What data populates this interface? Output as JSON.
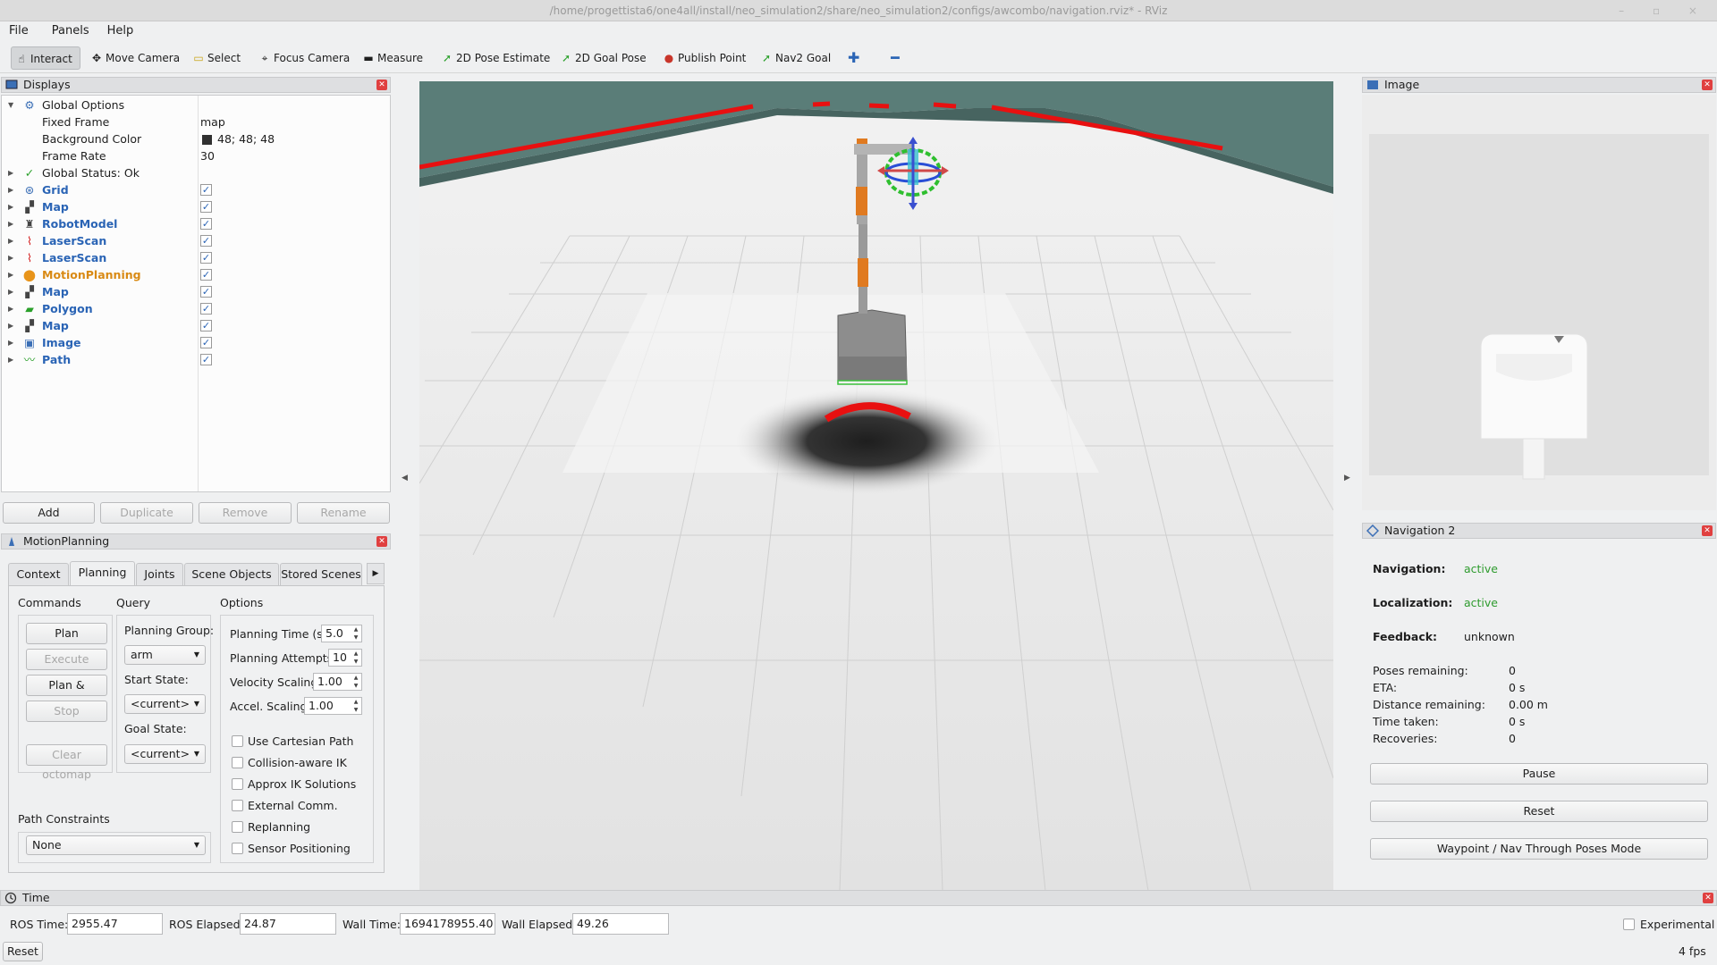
{
  "window": {
    "title": "/home/progettista6/one4all/install/neo_simulation2/share/neo_simulation2/configs/awcombo/navigation.rviz* - RViz"
  },
  "menu": [
    "File",
    "Panels",
    "Help"
  ],
  "toolbar": {
    "items": [
      {
        "label": "Interact",
        "icon": "interact-icon"
      },
      {
        "label": "Move Camera",
        "icon": "move-camera-icon"
      },
      {
        "label": "Select",
        "icon": "select-icon"
      },
      {
        "label": "Focus Camera",
        "icon": "focus-camera-icon"
      },
      {
        "label": "Measure",
        "icon": "measure-icon"
      },
      {
        "label": "2D Pose Estimate",
        "icon": "pose-estimate-icon"
      },
      {
        "label": "2D Goal Pose",
        "icon": "goal-pose-icon"
      },
      {
        "label": "Publish Point",
        "icon": "publish-point-icon"
      },
      {
        "label": "Nav2 Goal",
        "icon": "nav2-goal-icon"
      }
    ]
  },
  "displays": {
    "title": "Displays",
    "global_options": "Global Options",
    "fixed_frame": {
      "label": "Fixed Frame",
      "value": "map"
    },
    "background_color": {
      "label": "Background Color",
      "value": "48; 48; 48"
    },
    "frame_rate": {
      "label": "Frame Rate",
      "value": "30"
    },
    "global_status": "Global Status: Ok",
    "items": [
      {
        "label": "Grid",
        "checked": true
      },
      {
        "label": "Map",
        "checked": true
      },
      {
        "label": "RobotModel",
        "checked": true
      },
      {
        "label": "LaserScan",
        "checked": true
      },
      {
        "label": "LaserScan",
        "checked": true
      },
      {
        "label": "MotionPlanning",
        "checked": true
      },
      {
        "label": "Map",
        "checked": true
      },
      {
        "label": "Polygon",
        "checked": true
      },
      {
        "label": "Map",
        "checked": true
      },
      {
        "label": "Image",
        "checked": true
      },
      {
        "label": "Path",
        "checked": true
      }
    ],
    "buttons": {
      "add": "Add",
      "duplicate": "Duplicate",
      "remove": "Remove",
      "rename": "Rename"
    }
  },
  "motion_planning": {
    "title": "MotionPlanning",
    "tabs": [
      "Context",
      "Planning",
      "Joints",
      "Scene Objects",
      "Stored Scenes"
    ],
    "commands": {
      "title": "Commands",
      "plan": "Plan",
      "execute": "Execute",
      "plan_execute": "Plan & Execute",
      "stop": "Stop",
      "clear_octomap": "Clear octomap"
    },
    "query": {
      "title": "Query",
      "planning_group_label": "Planning Group:",
      "planning_group": "arm",
      "start_state_label": "Start State:",
      "start_state": "<current>",
      "goal_state_label": "Goal State:",
      "goal_state": "<current>"
    },
    "options": {
      "title": "Options",
      "planning_time_label": "Planning Time (s):",
      "planning_time": "5.0",
      "planning_attempts_label": "Planning Attempts:",
      "planning_attempts": "10",
      "velocity_scaling_label": "Velocity Scaling:",
      "velocity_scaling": "1.00",
      "accel_scaling_label": "Accel. Scaling:",
      "accel_scaling": "1.00",
      "checkboxes": [
        "Use Cartesian Path",
        "Collision-aware IK",
        "Approx IK Solutions",
        "External Comm.",
        "Replanning",
        "Sensor Positioning"
      ]
    },
    "path_constraints": {
      "label": "Path Constraints",
      "value": "None"
    }
  },
  "image_panel": {
    "title": "Image"
  },
  "nav2": {
    "title": "Navigation 2",
    "navigation": {
      "label": "Navigation:",
      "value": "active"
    },
    "localization": {
      "label": "Localization:",
      "value": "active"
    },
    "feedback": {
      "label": "Feedback:",
      "value": "unknown"
    },
    "poses_remaining": {
      "label": "Poses remaining:",
      "value": "0"
    },
    "eta": {
      "label": "ETA:",
      "value": "0 s"
    },
    "distance_remaining": {
      "label": "Distance remaining:",
      "value": "0.00 m"
    },
    "time_taken": {
      "label": "Time taken:",
      "value": "0 s"
    },
    "recoveries": {
      "label": "Recoveries:",
      "value": "0"
    },
    "buttons": {
      "pause": "Pause",
      "reset": "Reset",
      "waypoint": "Waypoint / Nav Through Poses Mode"
    }
  },
  "time": {
    "title": "Time",
    "ros_time_label": "ROS Time:",
    "ros_time": "2955.47",
    "ros_elapsed_label": "ROS Elapsed:",
    "ros_elapsed": "24.87",
    "wall_time_label": "Wall Time:",
    "wall_time": "1694178955.40",
    "wall_elapsed_label": "Wall Elapsed:",
    "wall_elapsed": "49.26",
    "experimental": "Experimental",
    "reset": "Reset",
    "fps": "4 fps"
  },
  "colors": {
    "accent_blue": "#2a64b5",
    "motion_planning_orange": "#d98a14",
    "active_green": "#2e9b2e",
    "laser_red": "#e81010",
    "wall_teal": "#5a7d78"
  }
}
